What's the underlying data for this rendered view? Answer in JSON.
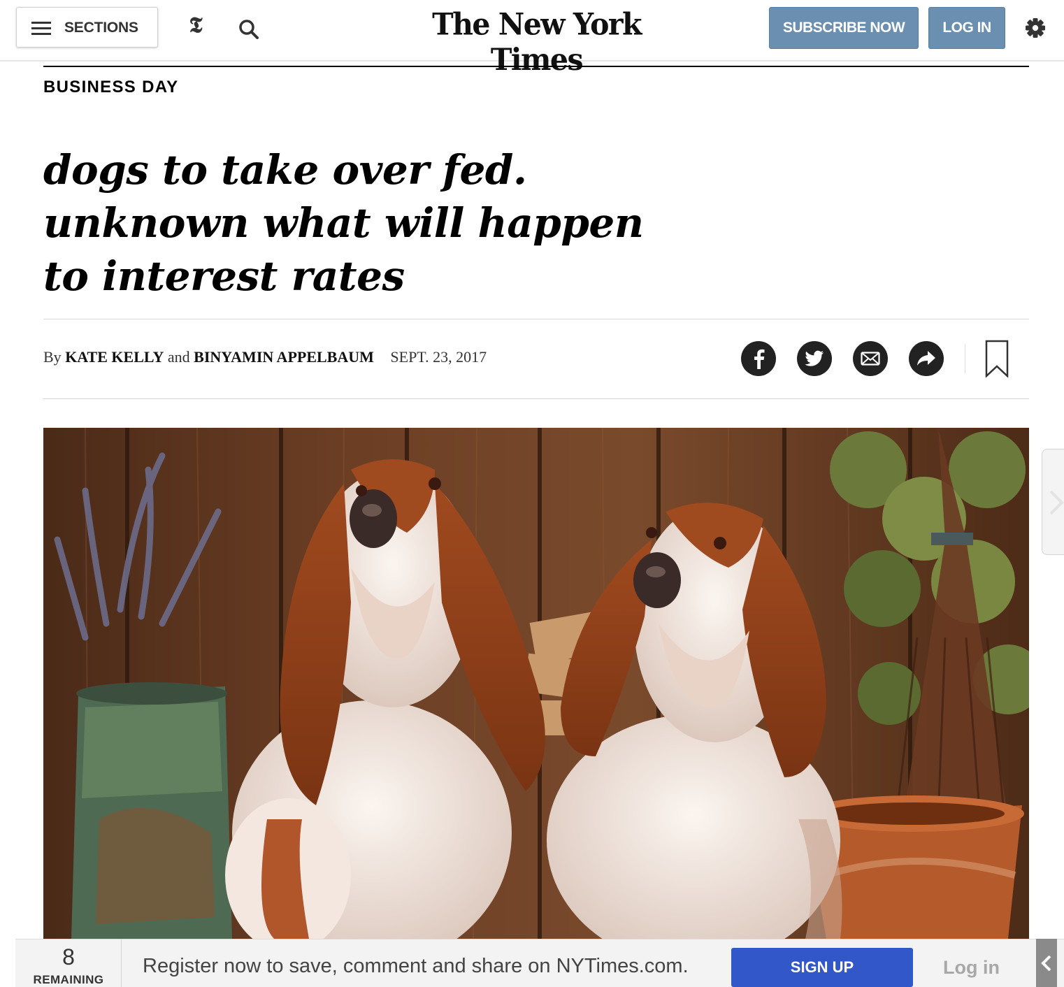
{
  "header": {
    "sections_label": "SECTIONS",
    "t_logo": "𝕿",
    "masthead": "The New York Times",
    "subscribe_label": "SUBSCRIBE NOW",
    "login_label": "LOG IN",
    "icons": [
      "hamburger-icon",
      "t-logo-icon",
      "search-icon",
      "gear-icon"
    ]
  },
  "article": {
    "section": "BUSINESS DAY",
    "headline": "dogs to take over fed. unknown what will happen to interest rates",
    "byline_prefix": "By",
    "author1": "KATE KELLY",
    "byline_and": "and",
    "author2": "BINYAMIN APPELBAUM",
    "date": "SEPT. 23, 2017",
    "share_icons": [
      "facebook-icon",
      "twitter-icon",
      "email-icon",
      "share-arrow-icon",
      "bookmark-icon"
    ],
    "photo_subject": "two-basset-hounds-photo"
  },
  "register_bar": {
    "remaining_count": "8",
    "remaining_label": "REMAINING",
    "message": "Register now to save, comment and share on NYTimes.com.",
    "signup_label": "SIGN UP",
    "login_label": "Log in"
  },
  "colors": {
    "header_button": "#6b8fb0",
    "signup_button": "#3157c8",
    "share_circle": "#222222"
  }
}
